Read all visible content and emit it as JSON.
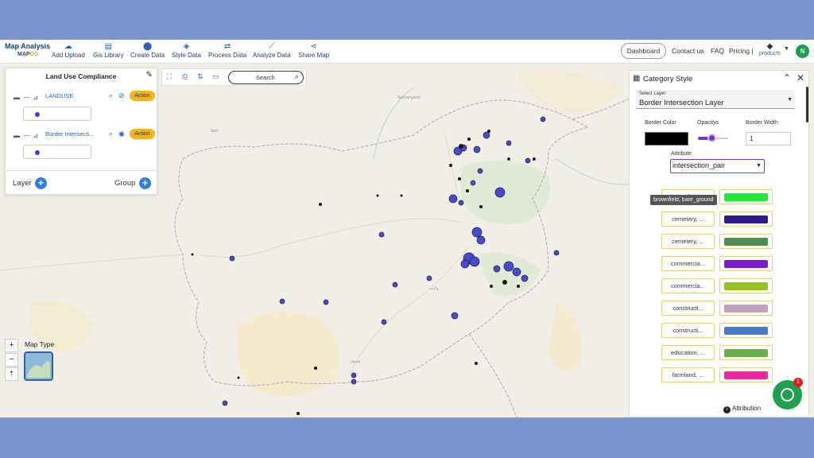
{
  "app": {
    "logo_line1": "Map Analysis",
    "logo_line2a": "MAP",
    "logo_line2b": "OG"
  },
  "nav": [
    {
      "label": "Add Upload",
      "icon": "cloud-upload-icon"
    },
    {
      "label": "Gis Library",
      "icon": "library-icon"
    },
    {
      "label": "Create Data",
      "icon": "map-pin-icon"
    },
    {
      "label": "Style Data",
      "icon": "paint-bucket-icon"
    },
    {
      "label": "Process Data",
      "icon": "process-icon"
    },
    {
      "label": "Analyze Data",
      "icon": "analyze-icon"
    },
    {
      "label": "Share Map",
      "icon": "share-icon"
    }
  ],
  "topright": {
    "dashboard": "Dashboard",
    "contact": "Contact us",
    "faq": "FAQ",
    "pricing": "Pricing |",
    "products": "products",
    "avatar": "N"
  },
  "layer_panel": {
    "title": "Land Use Compliance",
    "layers": [
      {
        "name": "LANDUSE",
        "action": "Action"
      },
      {
        "name": "Border Intersecti...",
        "action": "Action"
      }
    ],
    "layer_label": "Layer",
    "group_label": "Group"
  },
  "map_tools": {
    "search_placeholder": "Search"
  },
  "map_type": {
    "label": "Map Type"
  },
  "style_panel": {
    "title": "Category Style",
    "select_layer_label": "Select Layer",
    "select_layer_value": "Border Intersection Layer",
    "border_color_label": "Border Color",
    "opacity_label": "Opacitys",
    "opacity_value": 0.45,
    "border_width_label": "Border Width",
    "border_width_value": "1",
    "border_color": "#000000",
    "attribute_label": "Attribute",
    "attribute_value": "intersection_pair",
    "tooltip": "brownfield, bare_ground",
    "categories": [
      {
        "name": "brownfield,...",
        "color": "#1ee83a"
      },
      {
        "name": "cemetery, ...",
        "color": "#2e1a8c"
      },
      {
        "name": "cemetery, ...",
        "color": "#4c9050"
      },
      {
        "name": "commercia...",
        "color": "#7a1ac8"
      },
      {
        "name": "commercia...",
        "color": "#96c21c"
      },
      {
        "name": "constructi...",
        "color": "#c4a0c0"
      },
      {
        "name": "constructi...",
        "color": "#4a78c8"
      },
      {
        "name": "education, ...",
        "color": "#6cb04c"
      },
      {
        "name": "farmland, ...",
        "color": "#f0289c"
      }
    ]
  },
  "chat": {
    "badge": "1"
  },
  "attribution": "Attribution"
}
